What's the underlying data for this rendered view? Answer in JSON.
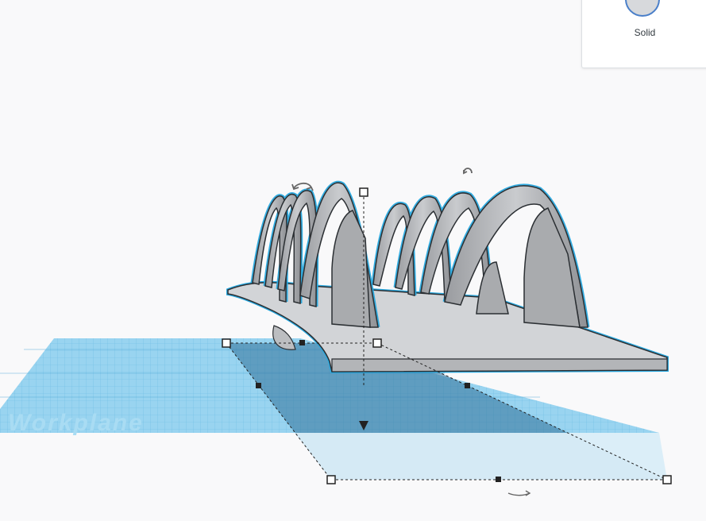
{
  "workplane": {
    "label": "Workplane"
  },
  "shape_panel": {
    "solid_label": "Solid"
  },
  "colors": {
    "grid_fill": "#8ecfee",
    "grid_line": "#5bb0dc",
    "selection_outline": "#29a9e0",
    "shape_fill": "#c9cbce",
    "shadow": "#4e7fa0",
    "solid_swatch": "#d7d9dc"
  },
  "icons": {
    "rotate_y": "rotate-arrow-icon",
    "rotate_z": "rotate-arrow-icon",
    "rotate_x": "rotate-arrow-icon",
    "lift": "cone-lift-icon"
  }
}
